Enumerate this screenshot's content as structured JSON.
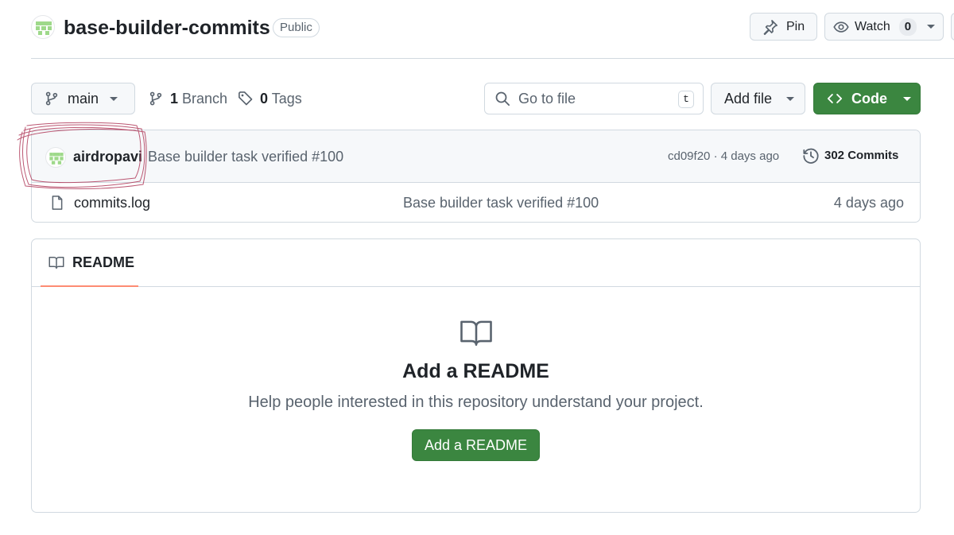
{
  "header": {
    "repo_name": "base-builder-commits",
    "visibility": "Public",
    "pin_label": "Pin",
    "watch_label": "Watch",
    "watch_count": "0"
  },
  "toolbar": {
    "branch": "main",
    "branch_count": "1",
    "branch_label": "Branch",
    "tag_count": "0",
    "tag_label": "Tags",
    "search_placeholder": "Go to file",
    "search_shortcut": "t",
    "add_file_label": "Add file",
    "code_label": "Code"
  },
  "latest_commit": {
    "author": "airdropavi",
    "message": "Base builder task verified #100",
    "hash": "cd09f20",
    "age": "4 days ago",
    "commits_count_label": "302 Commits"
  },
  "files": [
    {
      "name": "commits.log",
      "icon": "file-icon",
      "message": "Base builder task verified #100",
      "age": "4 days ago"
    }
  ],
  "readme": {
    "tab_label": "README",
    "title": "Add a README",
    "description": "Help people interested in this repository understand your project.",
    "button_label": "Add a README"
  },
  "colors": {
    "accent_green": "#3b8640",
    "tab_underline": "#fd8c73",
    "annotation": "#b03a5a",
    "identicon": "#9ed98a"
  }
}
